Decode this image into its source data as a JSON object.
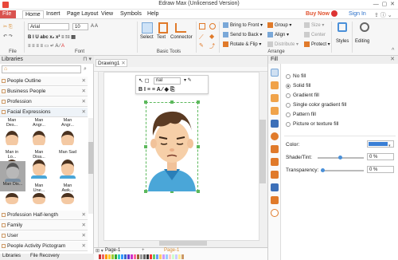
{
  "title": "Edraw Max (Unlicensed Version)",
  "top_right": {
    "buy_now": "Buy Now",
    "sign_in": "Sign In"
  },
  "menu": [
    "File",
    "Home",
    "Insert",
    "Page Layout",
    "View",
    "Symbols",
    "Help"
  ],
  "ribbon": {
    "file_label": "File",
    "font_name": "Arial",
    "font_size": "10",
    "font_group": "Font",
    "basic_tools_group": "Basic Tools",
    "select": "Select",
    "text": "Text",
    "connector": "Connector",
    "bring_to_front": "Bring to Front",
    "send_to_back": "Send to Back",
    "rotate_flip": "Rotate & Flip",
    "group": "Group",
    "align": "Align",
    "distribute": "Distribute",
    "size": "Size",
    "center": "Center",
    "protect": "Protect",
    "arrange_group": "Arrange",
    "styles": "Styles",
    "editing": "Editing"
  },
  "libraries": {
    "title": "Libraries",
    "categories_top": [
      "People Outline",
      "Business People",
      "Profession",
      "Facial Expressions"
    ],
    "shapes": [
      [
        "Man Des...",
        "Man Angr...",
        "Man Angr..."
      ],
      [
        "Man in Lo...",
        "Man Disa...",
        "Man Sad"
      ],
      [
        "Man Dis...",
        "Man Une...",
        "Man Awk..."
      ],
      [
        "",
        "",
        ""
      ]
    ],
    "categories_bottom": [
      "Profession Half-length",
      "Family",
      "User",
      "People Activity Pictogram"
    ],
    "bottom_tabs": [
      "Libraries",
      "File Recovery"
    ]
  },
  "canvas": {
    "tab": "Drawing1",
    "font_mini": "rial",
    "page_nav": "Page-1",
    "page_tab": "Page-1"
  },
  "fill": {
    "title": "Fill",
    "options": [
      "No fill",
      "Solid fill",
      "Gradient fill",
      "Single color gradient fill",
      "Pattern fill",
      "Picture or texture fill"
    ],
    "selected": 1,
    "color_label": "Color:",
    "color_value": "#3a7fd5",
    "shade_label": "Shade/Tint:",
    "shade_value": "0 %",
    "transparency_label": "Transparency:",
    "transparency_value": "0 %"
  }
}
